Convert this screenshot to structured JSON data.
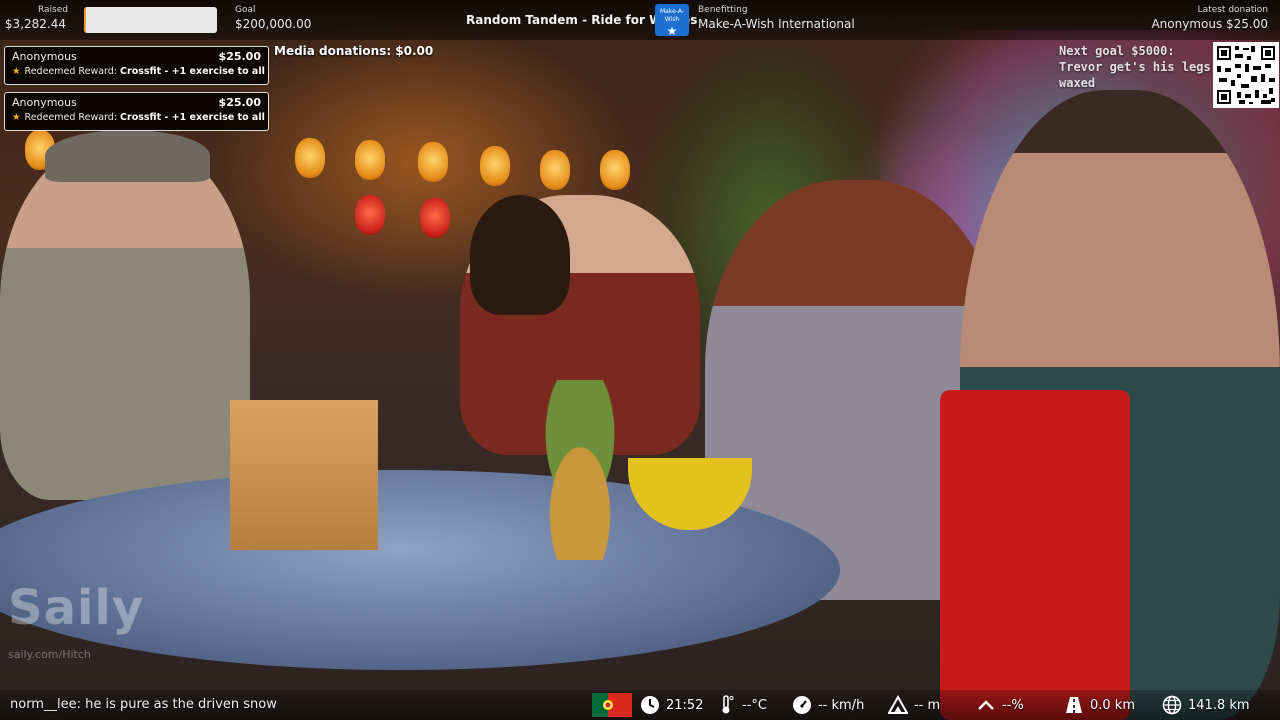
{
  "topbar": {
    "raised_label": "Raised",
    "raised_value": "$3,282.44",
    "progress_fraction": 0.0164,
    "goal_label": "Goal",
    "goal_value": "$200,000.00",
    "stream_title": "Random Tandem - Ride for Wishes",
    "charity_logo_text": "Make-A-Wish",
    "benefitting_label": "Benefitting",
    "benefitting_value": "Make-A-Wish International",
    "latest_label": "Latest donation",
    "latest_value": "Anonymous $25.00"
  },
  "alerts": [
    {
      "name": "Anonymous",
      "amount": "$25.00",
      "prefix": "Redeemed Reward: ",
      "reward": "Crossfit - +1 exercise to all"
    },
    {
      "name": "Anonymous",
      "amount": "$25.00",
      "prefix": "Redeemed Reward: ",
      "reward": "Crossfit - +1 exercise to all"
    }
  ],
  "media_donations": "Media donations: $0.00",
  "next_goal": "Next goal $5000: Trevor get's his legs waxed",
  "watermark": {
    "brand": "Saily",
    "url": "saily.com/Hitch"
  },
  "chat": {
    "message": "norm__lee: he is pure as the driven snow"
  },
  "stats": {
    "flag": "portugal-flag",
    "time": "21:52",
    "temperature": "--°C",
    "speed": "-- km/h",
    "altitude": "-- m",
    "incline": "--%",
    "distance_today": "0.0 km",
    "distance_total": "141.8 km"
  },
  "colors": {
    "progress_fill": "#f29a2e",
    "charity_blue": "#1d6fd1",
    "alert_star": "#f3b51e"
  }
}
